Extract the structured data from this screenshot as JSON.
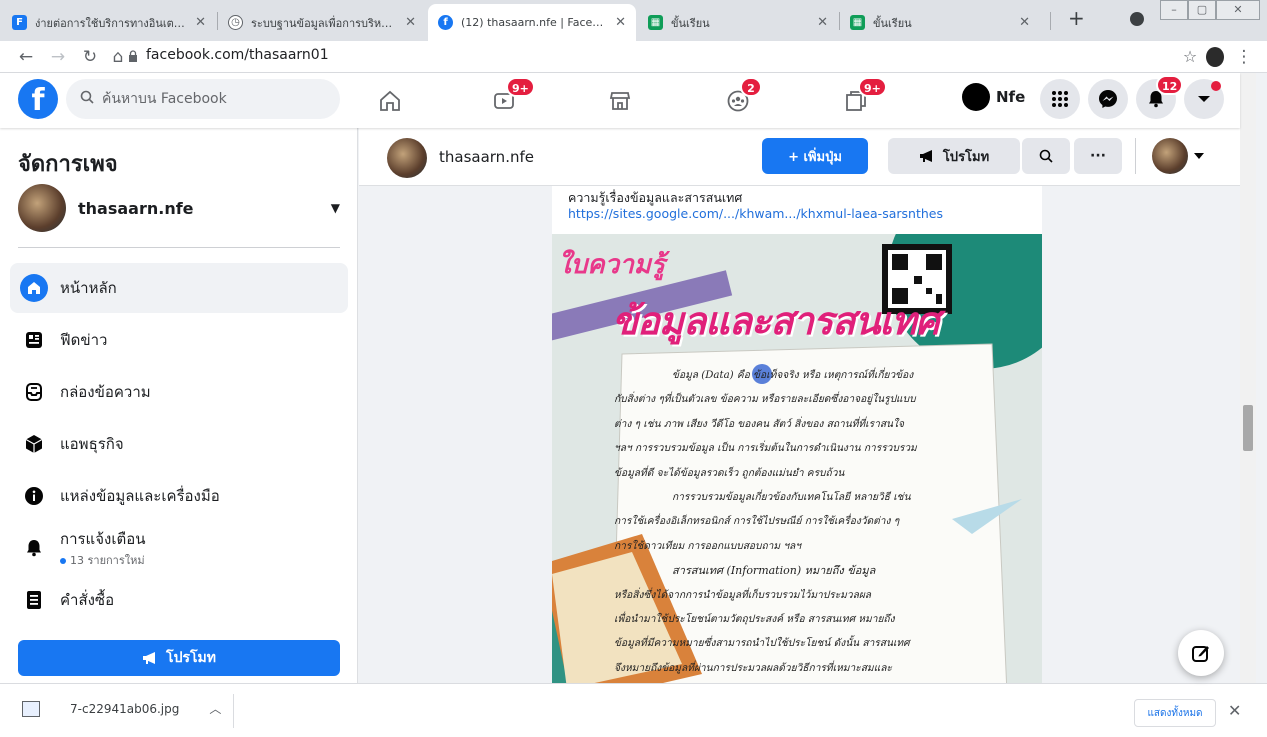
{
  "browser": {
    "tabs": [
      {
        "title": "ง่ายต่อการใช้บริการทางอินเตอร์เ",
        "icon": "facebook-square-icon",
        "color": "#1877f2"
      },
      {
        "title": "ระบบฐานข้อมูลเพื่อการบริหารจัด",
        "icon": "clock-icon",
        "color": "#5f6368"
      },
      {
        "title": "(12) thasaarn.nfe | Facebook",
        "icon": "facebook-icon",
        "color": "#1877f2"
      },
      {
        "title": "ขั้นเรียน",
        "icon": "classroom-icon",
        "color": "#0f9d58"
      },
      {
        "title": "ขั้นเรียน",
        "icon": "classroom-icon",
        "color": "#0f9d58"
      }
    ],
    "url": "facebook.com/thasaarn01"
  },
  "fb_nav": {
    "search_placeholder": "ค้นหาบน Facebook",
    "watch_badge": "9+",
    "groups_badge": "2",
    "gaming_badge": "9+",
    "profile_name": "Nfe",
    "notifications_badge": "12"
  },
  "sidebar": {
    "title": "จัดการเพจ",
    "page_name": "thasaarn.nfe",
    "items": [
      {
        "label": "หน้าหลัก",
        "icon": "home-icon"
      },
      {
        "label": "ฟีดข่าว",
        "icon": "news-feed-icon"
      },
      {
        "label": "กล่องข้อความ",
        "icon": "inbox-icon"
      },
      {
        "label": "แอพธุรกิจ",
        "icon": "business-apps-icon"
      },
      {
        "label": "แหล่งข้อมูลและเครื่องมือ",
        "icon": "info-icon"
      },
      {
        "label": "การแจ้งเตือน",
        "icon": "bell-icon",
        "sub": "13 รายการใหม่"
      },
      {
        "label": "คำสั่งซื้อ",
        "icon": "orders-icon"
      }
    ],
    "promote_label": "โปรโมท"
  },
  "page_header": {
    "page_name": "thasaarn.nfe",
    "add_button_label": "+ เพิ่มปุ่ม",
    "promote_label": "โปรโมท"
  },
  "post": {
    "text_line": "ความรู้เรื่องข้อมูลและสารสนเทศ",
    "link": "https://sites.google.com/.../khwam.../khxmul-laea-sarsnthes",
    "image": {
      "heading_small": "ใบความรู้",
      "heading_big": "ข้อมูลและสารสนเทศ",
      "paragraphs": [
        "ข้อมูล (Data) คือ ข้อเท็จจริง หรือ เหตุการณ์ที่เกี่ยวข้อง",
        "กับสิ่งต่าง ๆที่เป็นตัวเลข ข้อความ หรือรายละเอียดซึ่งอาจอยู่ในรูปแบบ",
        "ต่าง ๆ เช่น ภาพ เสียง วีดีโอ ของคน สัตว์ สิ่งของ สถานที่ที่เราสนใจ",
        "ฯลฯ การรวบรวมข้อมูล เป็น การเริ่มต้นในการดำเนินงาน การรวบรวม",
        "ข้อมูลที่ดี จะได้ข้อมูลรวดเร็ว ถูกต้องแม่นยำ ครบถ้วน",
        "การรวบรวมข้อมูลเกี่ยวข้องกับเทคโนโลยี หลายวิธี เช่น",
        "การใช้เครื่องอิเล็กทรอนิกส์ การใช้ไปรษณีย์ การใช้เครื่องวัดต่าง ๆ",
        "การใช้ดาวเทียม การออกแบบสอบถาม ฯลฯ",
        "สารสนเทศ (Information) หมายถึง ข้อมูล",
        "หรือสิ่งซึ่งได้จากการนำข้อมูลที่เก็บรวบรวมไว้มาประมวลผล",
        "เพื่อนำมาใช้ประโยชน์ตามวัตถุประสงค์ หรือ สารสนเทศ หมายถึง",
        "ข้อมูลที่มีความหมายซึ่งสามารถนำไปใช้ประโยชน์ ดังนั้น สารสนเทศ",
        "จึงหมายถึงข้อมูลที่ผ่านการประมวลผลด้วยวิธีการที่เหมาะสมและ"
      ]
    }
  },
  "download_bar": {
    "filename": "7-c22941ab06.jpg",
    "show_all_label": "แสดงทั้งหมด"
  },
  "colors": {
    "fb_blue": "#1877f2",
    "badge_red": "#e41e3f",
    "link_blue": "#216fdb"
  }
}
